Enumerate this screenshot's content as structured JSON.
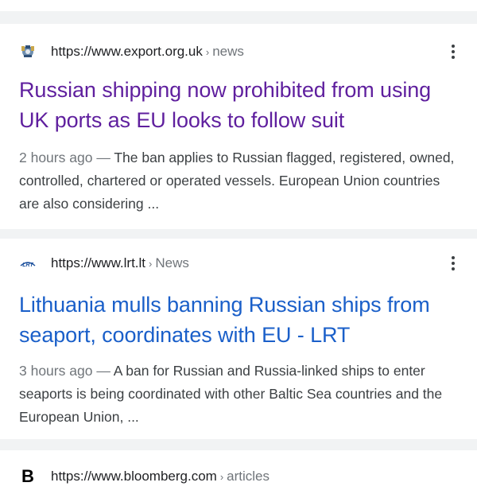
{
  "results": [
    {
      "url": "https://www.export.org.uk",
      "crumb": "news",
      "favicon": "export-org-crest-icon",
      "title": "Russian shipping now prohibited from using UK ports as EU looks to follow suit",
      "time": "2 hours ago",
      "dash": "—",
      "snippet": "The ban applies to Russian flagged, registered, owned, controlled, chartered or operated vessels. European Union countries are also considering ...",
      "visited": true
    },
    {
      "url": "https://www.lrt.lt",
      "crumb": "News",
      "favicon": "lrt-logo-icon",
      "favicon_text": "LRT",
      "title": "Lithuania mulls banning Russian ships from seaport, coordinates with EU - LRT",
      "time": "3 hours ago",
      "dash": "—",
      "snippet": "A ban for Russian and Russia-linked ships to enter seaports is being coordinated with other Baltic Sea countries and the European Union, ...",
      "visited": false
    },
    {
      "url": "https://www.bloomberg.com",
      "crumb": "articles",
      "favicon": "bloomberg-b-icon",
      "favicon_text": "B"
    }
  ],
  "colors": {
    "visited_link": "#5f1f9e",
    "link": "#1a5fc9",
    "page_bg": "#f1f3f4"
  }
}
